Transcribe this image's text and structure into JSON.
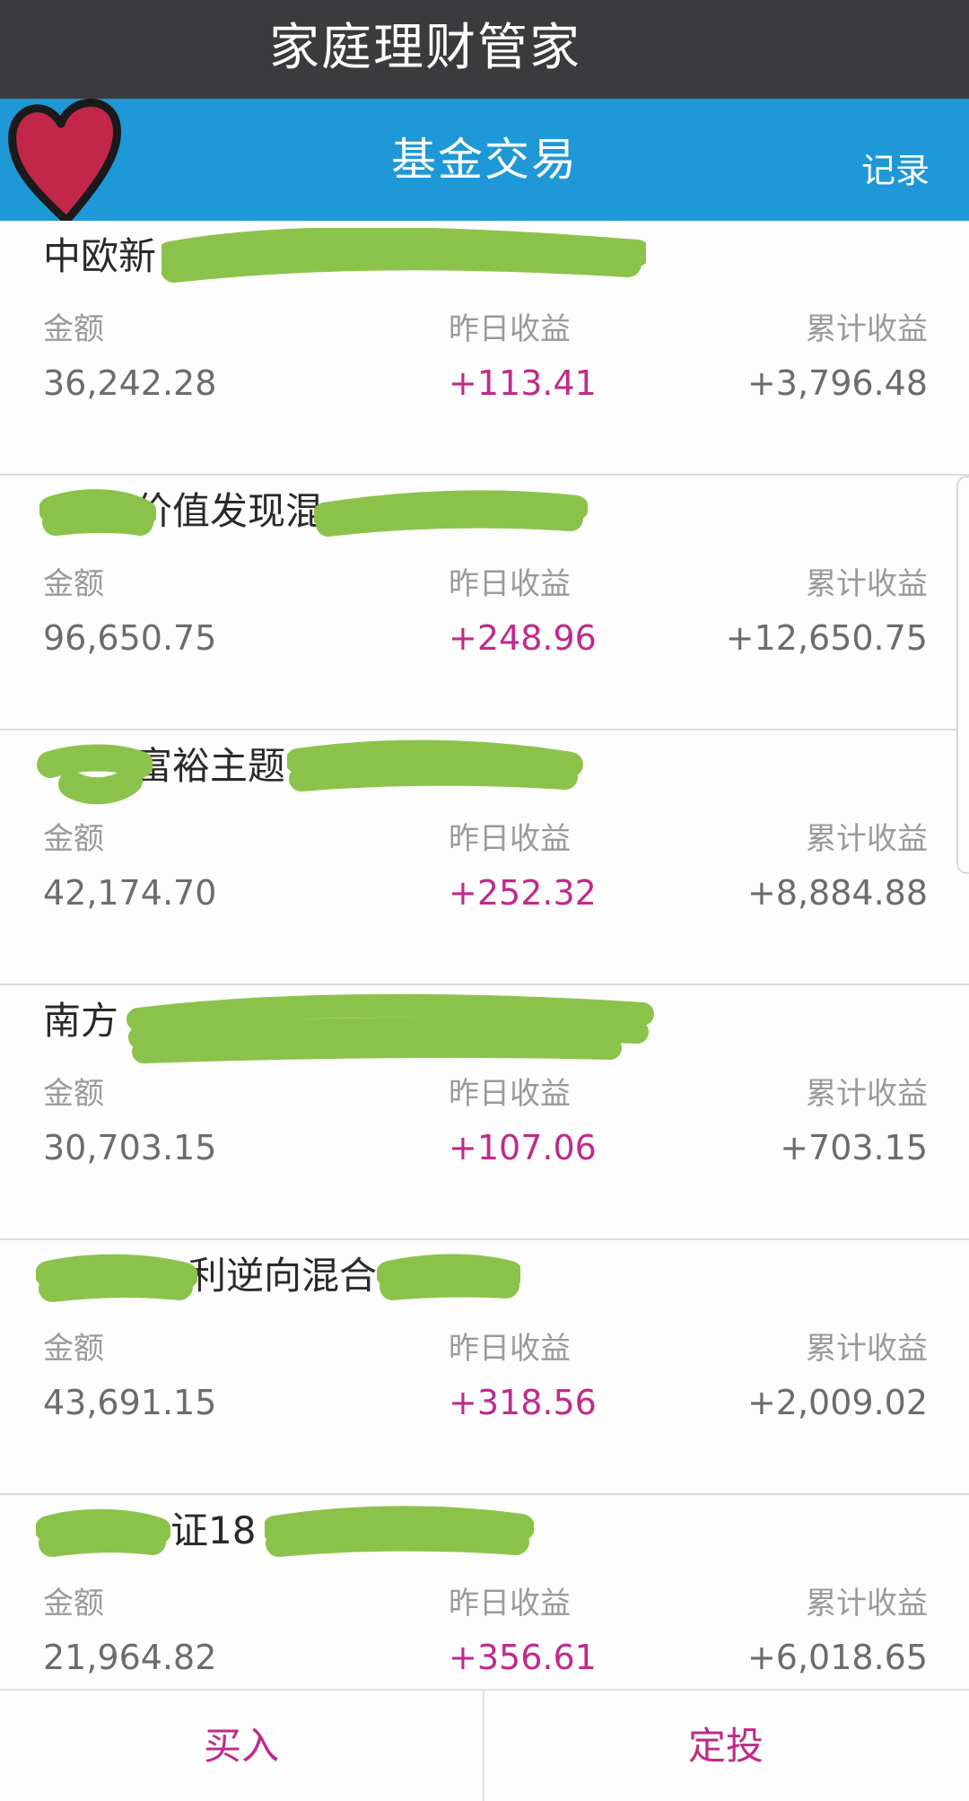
{
  "app": {
    "title": "家庭理财管家"
  },
  "header": {
    "title": "基金交易",
    "action": "记录"
  },
  "labels": {
    "amount": "金额",
    "yesterday": "昨日收益",
    "total": "累计收益"
  },
  "funds": [
    {
      "name": "中欧新",
      "amount": "36,242.28",
      "yesterday": "+113.41",
      "total": "+3,796.48"
    },
    {
      "name": "价值发现混",
      "amount": "96,650.75",
      "yesterday": "+248.96",
      "total": "+12,650.75"
    },
    {
      "name": "富裕主题",
      "amount": "42,174.70",
      "yesterday": "+252.32",
      "total": "+8,884.88"
    },
    {
      "name": "南方",
      "amount": "30,703.15",
      "yesterday": "+107.06",
      "total": "+703.15"
    },
    {
      "name": "利逆向混合",
      "amount": "43,691.15",
      "yesterday": "+318.56",
      "total": "+2,009.02"
    },
    {
      "name": "证18",
      "amount": "21,964.82",
      "yesterday": "+356.61",
      "total": "+6,018.65"
    }
  ],
  "footer": {
    "buy": "买入",
    "plan": "定投"
  },
  "colors": {
    "nav": "#1e98d6",
    "title_bar": "#3b3b3d",
    "accent": "#c02a8a",
    "scribble": "#8bc34a",
    "heart": "#c2274a"
  }
}
